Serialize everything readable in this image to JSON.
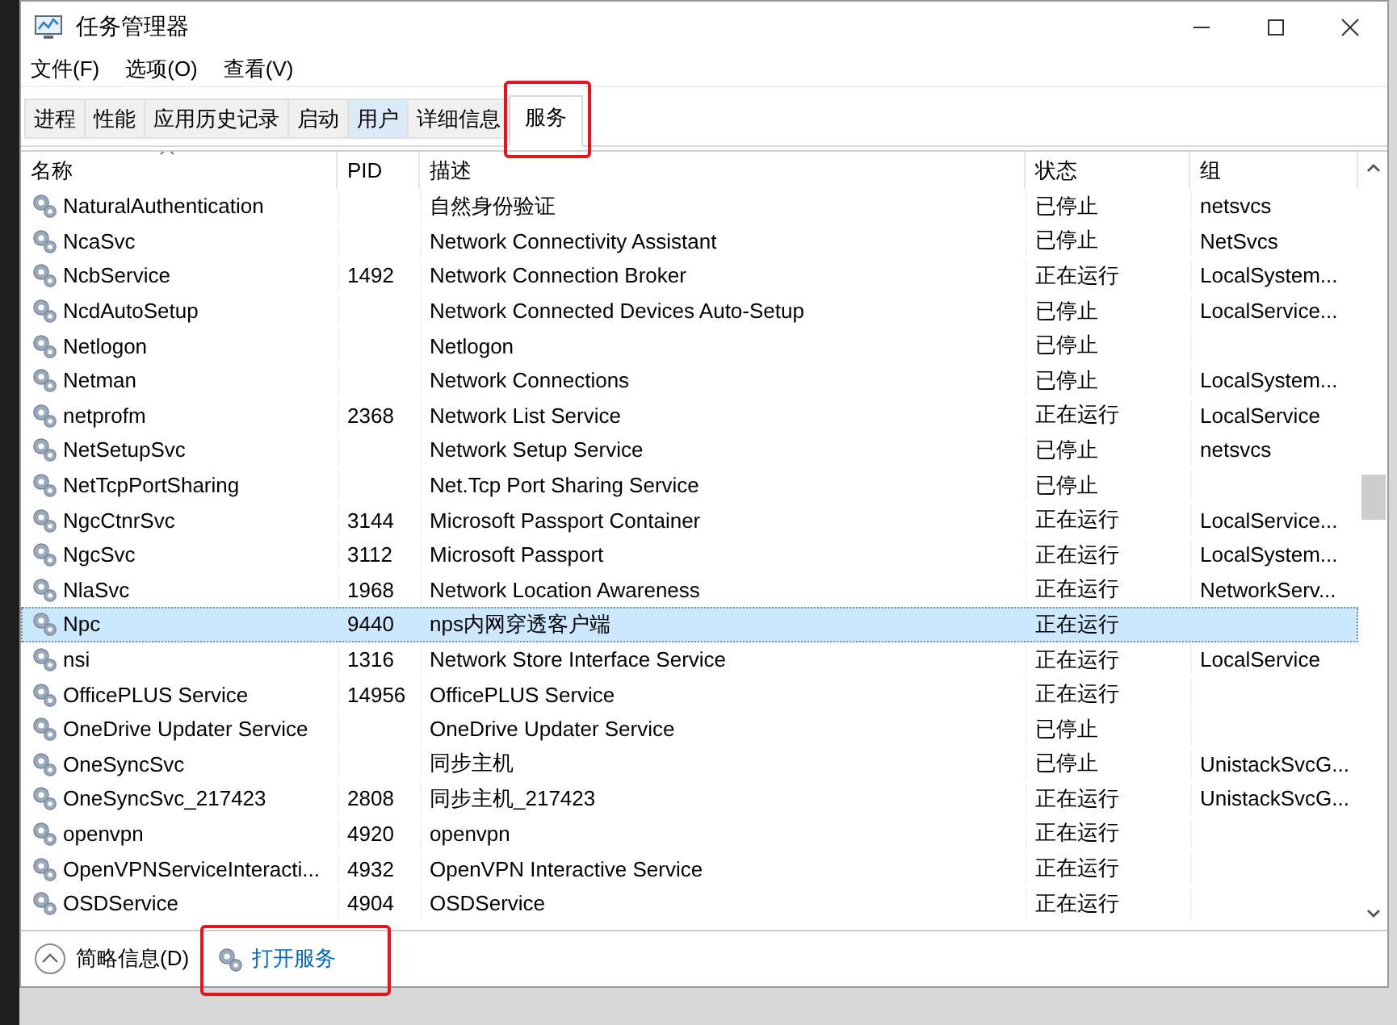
{
  "window": {
    "title": "任务管理器"
  },
  "menu": [
    "文件(F)",
    "选项(O)",
    "查看(V)"
  ],
  "tabs": [
    {
      "label": "进程",
      "selected": false,
      "hovered": false,
      "highlighted": false
    },
    {
      "label": "性能",
      "selected": false,
      "hovered": false,
      "highlighted": false
    },
    {
      "label": "应用历史记录",
      "selected": false,
      "hovered": false,
      "highlighted": false
    },
    {
      "label": "启动",
      "selected": false,
      "hovered": false,
      "highlighted": false
    },
    {
      "label": "用户",
      "selected": false,
      "hovered": true,
      "highlighted": false
    },
    {
      "label": "详细信息",
      "selected": false,
      "hovered": false,
      "highlighted": false
    },
    {
      "label": "服务",
      "selected": true,
      "hovered": false,
      "highlighted": true
    }
  ],
  "table": {
    "columns": [
      "名称",
      "PID",
      "描述",
      "状态",
      "组"
    ],
    "rows": [
      {
        "name": "NaturalAuthentication",
        "pid": "",
        "description": "自然身份验证",
        "status": "已停止",
        "group": "netsvcs",
        "selected": false
      },
      {
        "name": "NcaSvc",
        "pid": "",
        "description": "Network Connectivity Assistant",
        "status": "已停止",
        "group": "NetSvcs",
        "selected": false
      },
      {
        "name": "NcbService",
        "pid": "1492",
        "description": "Network Connection Broker",
        "status": "正在运行",
        "group": "LocalSystem...",
        "selected": false
      },
      {
        "name": "NcdAutoSetup",
        "pid": "",
        "description": "Network Connected Devices Auto-Setup",
        "status": "已停止",
        "group": "LocalService...",
        "selected": false
      },
      {
        "name": "Netlogon",
        "pid": "",
        "description": "Netlogon",
        "status": "已停止",
        "group": "",
        "selected": false
      },
      {
        "name": "Netman",
        "pid": "",
        "description": "Network Connections",
        "status": "已停止",
        "group": "LocalSystem...",
        "selected": false
      },
      {
        "name": "netprofm",
        "pid": "2368",
        "description": "Network List Service",
        "status": "正在运行",
        "group": "LocalService",
        "selected": false
      },
      {
        "name": "NetSetupSvc",
        "pid": "",
        "description": "Network Setup Service",
        "status": "已停止",
        "group": "netsvcs",
        "selected": false
      },
      {
        "name": "NetTcpPortSharing",
        "pid": "",
        "description": "Net.Tcp Port Sharing Service",
        "status": "已停止",
        "group": "",
        "selected": false
      },
      {
        "name": "NgcCtnrSvc",
        "pid": "3144",
        "description": "Microsoft Passport Container",
        "status": "正在运行",
        "group": "LocalService...",
        "selected": false
      },
      {
        "name": "NgcSvc",
        "pid": "3112",
        "description": "Microsoft Passport",
        "status": "正在运行",
        "group": "LocalSystem...",
        "selected": false
      },
      {
        "name": "NlaSvc",
        "pid": "1968",
        "description": "Network Location Awareness",
        "status": "正在运行",
        "group": "NetworkServ...",
        "selected": false
      },
      {
        "name": "Npc",
        "pid": "9440",
        "description": "nps内网穿透客户端",
        "status": "正在运行",
        "group": "",
        "selected": true
      },
      {
        "name": "nsi",
        "pid": "1316",
        "description": "Network Store Interface Service",
        "status": "正在运行",
        "group": "LocalService",
        "selected": false
      },
      {
        "name": "OfficePLUS Service",
        "pid": "14956",
        "description": "OfficePLUS Service",
        "status": "正在运行",
        "group": "",
        "selected": false
      },
      {
        "name": "OneDrive Updater Service",
        "pid": "",
        "description": "OneDrive Updater Service",
        "status": "已停止",
        "group": "",
        "selected": false
      },
      {
        "name": "OneSyncSvc",
        "pid": "",
        "description": "同步主机",
        "status": "已停止",
        "group": "UnistackSvcG...",
        "selected": false
      },
      {
        "name": "OneSyncSvc_217423",
        "pid": "2808",
        "description": "同步主机_217423",
        "status": "正在运行",
        "group": "UnistackSvcG...",
        "selected": false
      },
      {
        "name": "openvpn",
        "pid": "4920",
        "description": "openvpn",
        "status": "正在运行",
        "group": "",
        "selected": false
      },
      {
        "name": "OpenVPNServiceInteracti...",
        "pid": "4932",
        "description": "OpenVPN Interactive Service",
        "status": "正在运行",
        "group": "",
        "selected": false
      },
      {
        "name": "OSDService",
        "pid": "4904",
        "description": "OSDService",
        "status": "正在运行",
        "group": "",
        "selected": false
      }
    ]
  },
  "footer": {
    "details": "简略信息(D)",
    "open_services": {
      "label": "打开服务",
      "highlighted": true
    }
  }
}
